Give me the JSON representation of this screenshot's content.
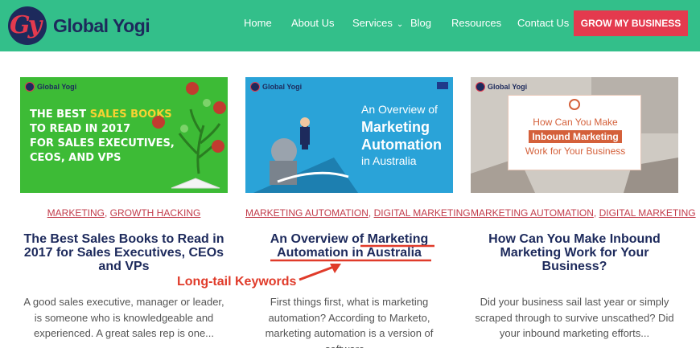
{
  "header": {
    "logo_text": "Global Yogi",
    "logo_initials": "Gy",
    "nav": [
      {
        "label": "Home"
      },
      {
        "label": "About Us"
      },
      {
        "label": "Services"
      },
      {
        "label": "Blog"
      },
      {
        "label": "Resources"
      },
      {
        "label": "Contact Us"
      }
    ],
    "cta_label": "GROW MY BUSINESS"
  },
  "cards": [
    {
      "thumb": {
        "brand": "Global Yogi",
        "line1_a": "THE BEST ",
        "line1_b": "SALES BOOKS",
        "line2": "TO READ IN 2017",
        "line3": "FOR SALES EXECUTIVES,",
        "line4": "CEOS, AND VPS"
      },
      "categories": [
        "MARKETING",
        "GROWTH HACKING"
      ],
      "title": "The Best Sales Books to Read in 2017 for Sales Executives, CEOs and VPs",
      "excerpt": "A good sales executive, manager or leader, is someone who is knowledgeable and experienced. A great sales rep is one..."
    },
    {
      "thumb": {
        "brand": "Global Yogi",
        "line1": "An Overview of",
        "line2": "Marketing",
        "line3": "Automation",
        "line4": "in Australia"
      },
      "categories": [
        "MARKETING AUTOMATION",
        "DIGITAL MARKETING"
      ],
      "title": "An Overview of Marketing Automation in Australia",
      "excerpt": "First things first, what is marketing automation? According to Marketo, marketing automation is a version of software..."
    },
    {
      "thumb": {
        "brand": "Global Yogi",
        "line1": "How Can You Make",
        "line2": "Inbound Marketing",
        "line3": "Work for Your Business"
      },
      "categories": [
        "MARKETING AUTOMATION",
        "DIGITAL MARKETING"
      ],
      "title": "How Can You Make Inbound Marketing Work for Your Business?",
      "excerpt": "Did your business sail last year or simply scraped through to survive unscathed? Did your inbound marketing efforts..."
    }
  ],
  "annotation": {
    "label": "Long-tail Keywords",
    "color": "#e03b2a"
  },
  "colors": {
    "header_bg": "#33bf8a",
    "cta_bg": "#e43a4e",
    "title_color": "#1d2a5c",
    "category_color": "#c23b4a"
  }
}
